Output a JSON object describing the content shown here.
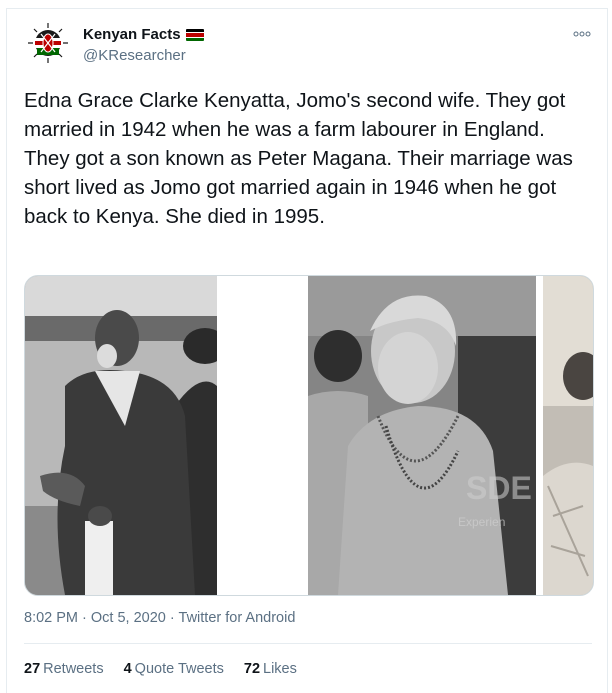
{
  "account": {
    "display_name": "Kenyan Facts",
    "flag_icon": "kenya-flag-icon",
    "handle": "@KResearcher",
    "avatar_icon": "kenya-coat-of-arms-icon"
  },
  "more_icon": "more-options-icon",
  "tweet": {
    "text": "Edna Grace Clarke Kenyatta, Jomo's second wife. They got married in 1942 when he was a farm labourer in England.\nThey got a son known as Peter Magana. Their marriage was short lived as Jomo got married again in 1946 when he got back to Kenya. She died in 1995."
  },
  "media": {
    "watermark_brand": "SDE",
    "watermark_text": "Experien"
  },
  "meta": {
    "time": "8:02 PM",
    "separator": "·",
    "date": "Oct 5, 2020",
    "source": "Twitter for Android"
  },
  "stats": {
    "retweets_count": "27",
    "retweets_label": "Retweets",
    "quotes_count": "4",
    "quotes_label": "Quote Tweets",
    "likes_count": "72",
    "likes_label": "Likes"
  },
  "colors": {
    "text": "#0f1419",
    "secondary": "#5b7083",
    "border": "#e6ecf0",
    "flag_black": "#000000",
    "flag_red": "#bb0000",
    "flag_green": "#006600"
  }
}
